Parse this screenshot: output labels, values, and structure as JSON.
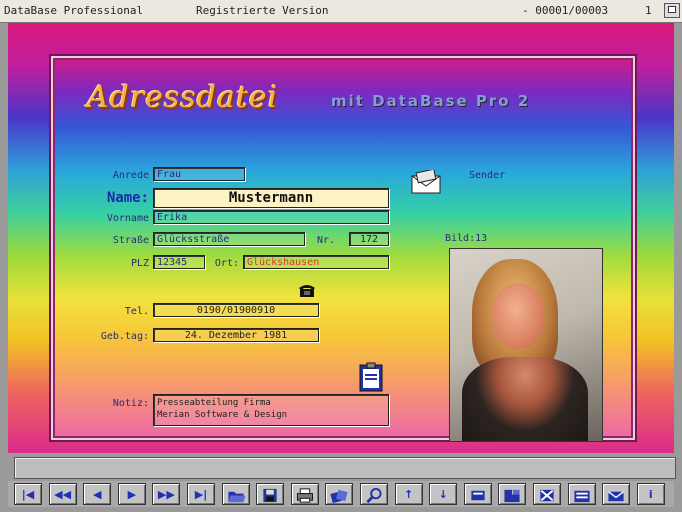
{
  "titlebar": {
    "app_name": "DataBase Professional",
    "version": "Registrierte Version",
    "record_counter": "-  00001/00003",
    "page_number": "1"
  },
  "header": {
    "title": "Adressdatei",
    "subtitle": "mit DataBase Pro 2"
  },
  "form": {
    "anrede": {
      "label": "Anrede",
      "value": "Frau"
    },
    "name": {
      "label": "Name:",
      "value": "Mustermann"
    },
    "vorname": {
      "label": "Vorname",
      "value": "Erika"
    },
    "strasse": {
      "label": "Straße",
      "value": "Glücksstraße"
    },
    "nr": {
      "label": "Nr.",
      "value": "172"
    },
    "plz": {
      "label": "PLZ",
      "value": "12345"
    },
    "ort": {
      "label": "Ort:",
      "value": "Glückshausen"
    },
    "tel": {
      "label": "Tel.",
      "value": "0190/01900910"
    },
    "geburtstag": {
      "label": "Geb.tag:",
      "value": "24. Dezember 1981"
    },
    "notiz": {
      "label": "Notiz:",
      "line1": "Presseabteilung Firma",
      "line2": "Merian Software & Design"
    },
    "bild_label": "Bild:13",
    "envelope_label": "Sender"
  },
  "toolbar": {
    "buttons": [
      {
        "name": "first-record-button",
        "label": "|◀",
        "icon": "first-icon"
      },
      {
        "name": "fast-back-button",
        "label": "◀◀",
        "icon": "fast-back-icon"
      },
      {
        "name": "prev-record-button",
        "label": "◀",
        "icon": "prev-icon"
      },
      {
        "name": "next-record-button",
        "label": "▶",
        "icon": "next-icon"
      },
      {
        "name": "fast-forward-button",
        "label": "▶▶",
        "icon": "fast-forward-icon"
      },
      {
        "name": "last-record-button",
        "label": "▶|",
        "icon": "last-icon"
      },
      {
        "name": "open-button",
        "label": "",
        "icon": "open-folder-icon"
      },
      {
        "name": "save-button",
        "label": "",
        "icon": "disk-icon"
      },
      {
        "name": "print-button",
        "label": "",
        "icon": "printer-icon"
      },
      {
        "name": "cards-button",
        "label": "",
        "icon": "cards-icon"
      },
      {
        "name": "search-button",
        "label": "",
        "icon": "search-icon"
      },
      {
        "name": "sort-up-button",
        "label": "↑",
        "icon": "arrow-up-icon"
      },
      {
        "name": "sort-down-button",
        "label": "↓",
        "icon": "arrow-down-icon"
      },
      {
        "name": "new-record-button",
        "label": "",
        "icon": "new-card-icon"
      },
      {
        "name": "copy-record-button",
        "label": "",
        "icon": "copy-card-icon"
      },
      {
        "name": "delete-record-button",
        "label": "",
        "icon": "delete-card-icon"
      },
      {
        "name": "list-button",
        "label": "",
        "icon": "list-icon"
      },
      {
        "name": "mail-button",
        "label": "",
        "icon": "mail-icon"
      },
      {
        "name": "info-button",
        "label": "i",
        "icon": "info-icon"
      }
    ]
  }
}
